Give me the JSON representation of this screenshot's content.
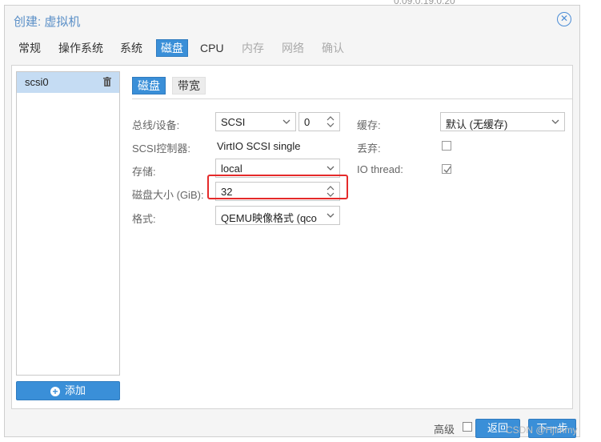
{
  "background": {
    "text": "0.09.0.19.0.20"
  },
  "dialog": {
    "title": "创建: 虚拟机",
    "tabs": [
      {
        "label": "常规",
        "state": "normal"
      },
      {
        "label": "操作系统",
        "state": "normal"
      },
      {
        "label": "系统",
        "state": "normal"
      },
      {
        "label": "磁盘",
        "state": "active"
      },
      {
        "label": "CPU",
        "state": "normal"
      },
      {
        "label": "内存",
        "state": "disabled"
      },
      {
        "label": "网络",
        "state": "disabled"
      },
      {
        "label": "确认",
        "state": "disabled"
      }
    ]
  },
  "disk_list": {
    "items": [
      {
        "label": "scsi0",
        "selected": true
      }
    ],
    "add_label": "添加"
  },
  "subtabs": {
    "disk": "磁盘",
    "bandwidth": "带宽"
  },
  "form": {
    "bus_label": "总线/设备:",
    "bus_value": "SCSI",
    "device_value": "0",
    "controller_label": "SCSI控制器:",
    "controller_value": "VirtIO SCSI single",
    "storage_label": "存储:",
    "storage_value": "local",
    "size_label": "磁盘大小 (GiB):",
    "size_value": "32",
    "format_label": "格式:",
    "format_value": "QEMU映像格式 (qco",
    "cache_label": "缓存:",
    "cache_value": "默认 (无缓存)",
    "discard_label": "丢弃:",
    "discard_checked": false,
    "iothread_label": "IO thread:",
    "iothread_checked": true
  },
  "footer": {
    "advanced_label": "高级",
    "back_label": "返回",
    "next_label": "下一步"
  },
  "watermark": "CSDN @Hjimmy",
  "colors": {
    "accent": "#3a8fd8",
    "highlight": "#e52a2a",
    "title": "#5a8fc7"
  }
}
